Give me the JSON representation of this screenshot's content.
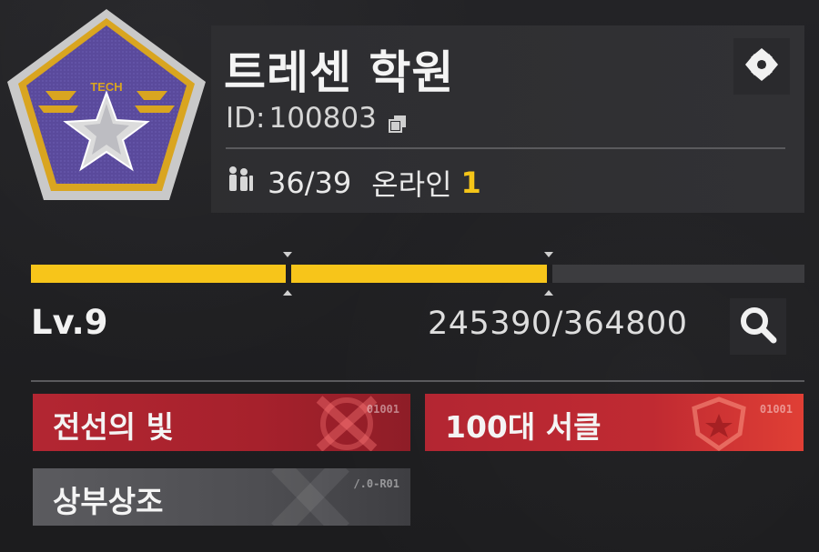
{
  "club": {
    "emblem_text": "TECH",
    "name": "트레센 학원",
    "id_label": "ID:",
    "id_value": "100803",
    "members": "36/39",
    "online_label": "온라인",
    "online_count": "1"
  },
  "icons": {
    "copy": "copy-icon",
    "members": "members-icon",
    "settings": "settings-icon",
    "search": "search-icon"
  },
  "level": {
    "label": "Lv.9",
    "xp_current": 245390,
    "xp_max": 364800,
    "xp_text": "245390/364800",
    "progress_fraction": 0.6724,
    "milestones_fraction": [
      0.3329,
      0.6706
    ]
  },
  "tags": [
    {
      "label": "전선의 빛",
      "code": "01001",
      "style": "red",
      "icon": "crossed-swords-icon"
    },
    {
      "label": "100대 서클",
      "code": "01001",
      "style": "red",
      "icon": "star-shield-icon"
    },
    {
      "label": "상부상조",
      "code": "/.0-R01",
      "style": "grey",
      "icon": "cross-stripes-icon"
    }
  ],
  "colors": {
    "accent_yellow": "#f7c51a",
    "tag_red": "#b32632",
    "tag_grey": "#5b5b5f",
    "emblem_purple": "#5a4a9c",
    "emblem_gold": "#d9a520"
  }
}
